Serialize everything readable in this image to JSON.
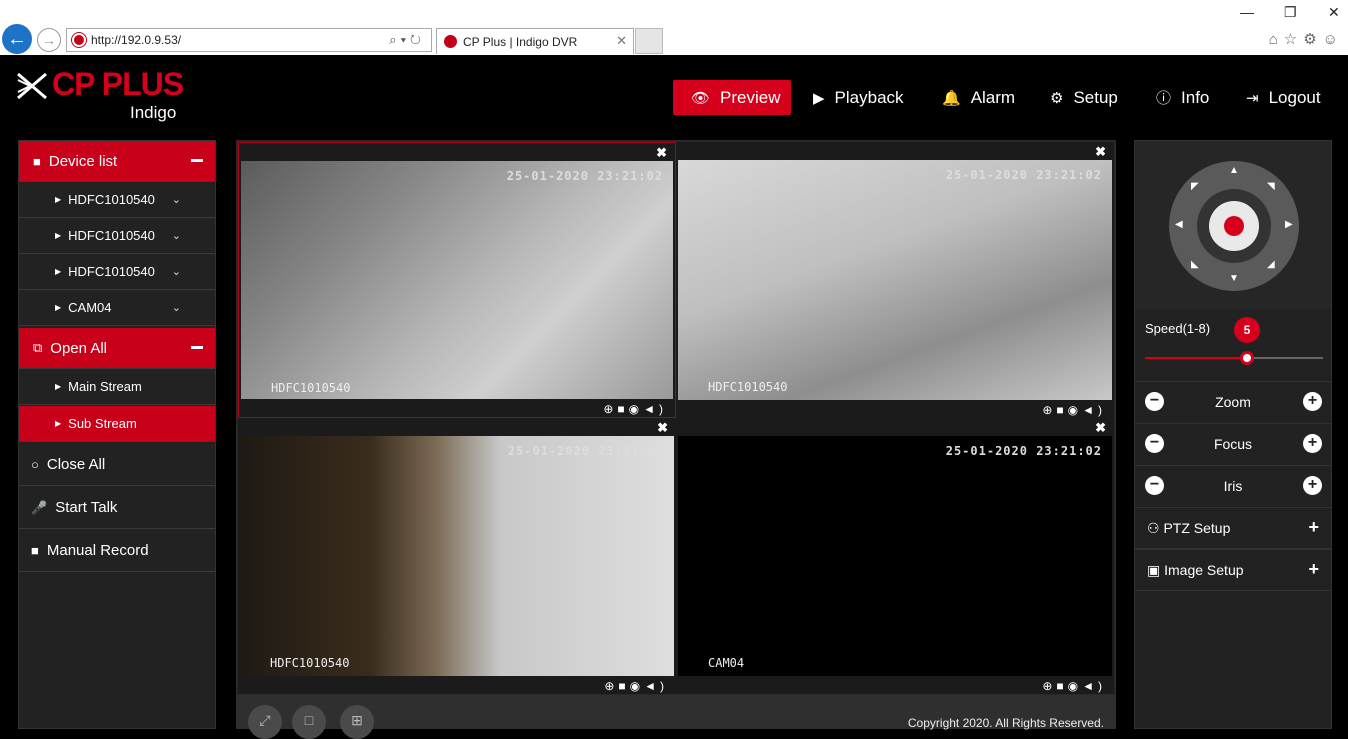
{
  "browser": {
    "url": "http://192.0.9.53/",
    "tab_title": "CP Plus | Indigo DVR",
    "minimize": "—",
    "restore": "❐",
    "close": "✕"
  },
  "brand": {
    "name": "CP PLUS",
    "product": "Indigo",
    "color": "#d6001c"
  },
  "topnav": [
    {
      "label": "Preview",
      "icon": "eye-icon",
      "active": true
    },
    {
      "label": "Playback",
      "icon": "play-icon"
    },
    {
      "label": "Alarm",
      "icon": "bell-icon"
    },
    {
      "label": "Setup",
      "icon": "gear-icon"
    },
    {
      "label": "Info",
      "icon": "info-icon"
    },
    {
      "label": "Logout",
      "icon": "logout-icon"
    }
  ],
  "sidebar": {
    "device_list": "Device list",
    "devices": [
      "HDFC1010540",
      "HDFC1010540",
      "HDFC1010540",
      "CAM04"
    ],
    "open_all": "Open All",
    "streams": [
      "Main Stream",
      "Sub Stream"
    ],
    "selected_stream": "Sub Stream",
    "close_all": "Close All",
    "start_talk": "Start Talk",
    "manual_record": "Manual Record"
  },
  "cameras": [
    {
      "name": "HDFC1010540",
      "timestamp": "25-01-2020 23:21:02"
    },
    {
      "name": "HDFC1010540",
      "timestamp": "25-01-2020 23:21:02"
    },
    {
      "name": "HDFC1010540",
      "timestamp": "25-01-2020 23:21:02"
    },
    {
      "name": "CAM04",
      "timestamp": "25-01-2020 23:21:02"
    }
  ],
  "footer": {
    "copyright": "Copyright 2020. All Rights Reserved."
  },
  "ptz": {
    "speed_label": "Speed(1-8)",
    "speed_value": "5",
    "speed_min": 1,
    "speed_max": 8,
    "zoom": "Zoom",
    "focus": "Focus",
    "iris": "Iris",
    "ptz_setup": "PTZ Setup",
    "image_setup": "Image Setup"
  }
}
